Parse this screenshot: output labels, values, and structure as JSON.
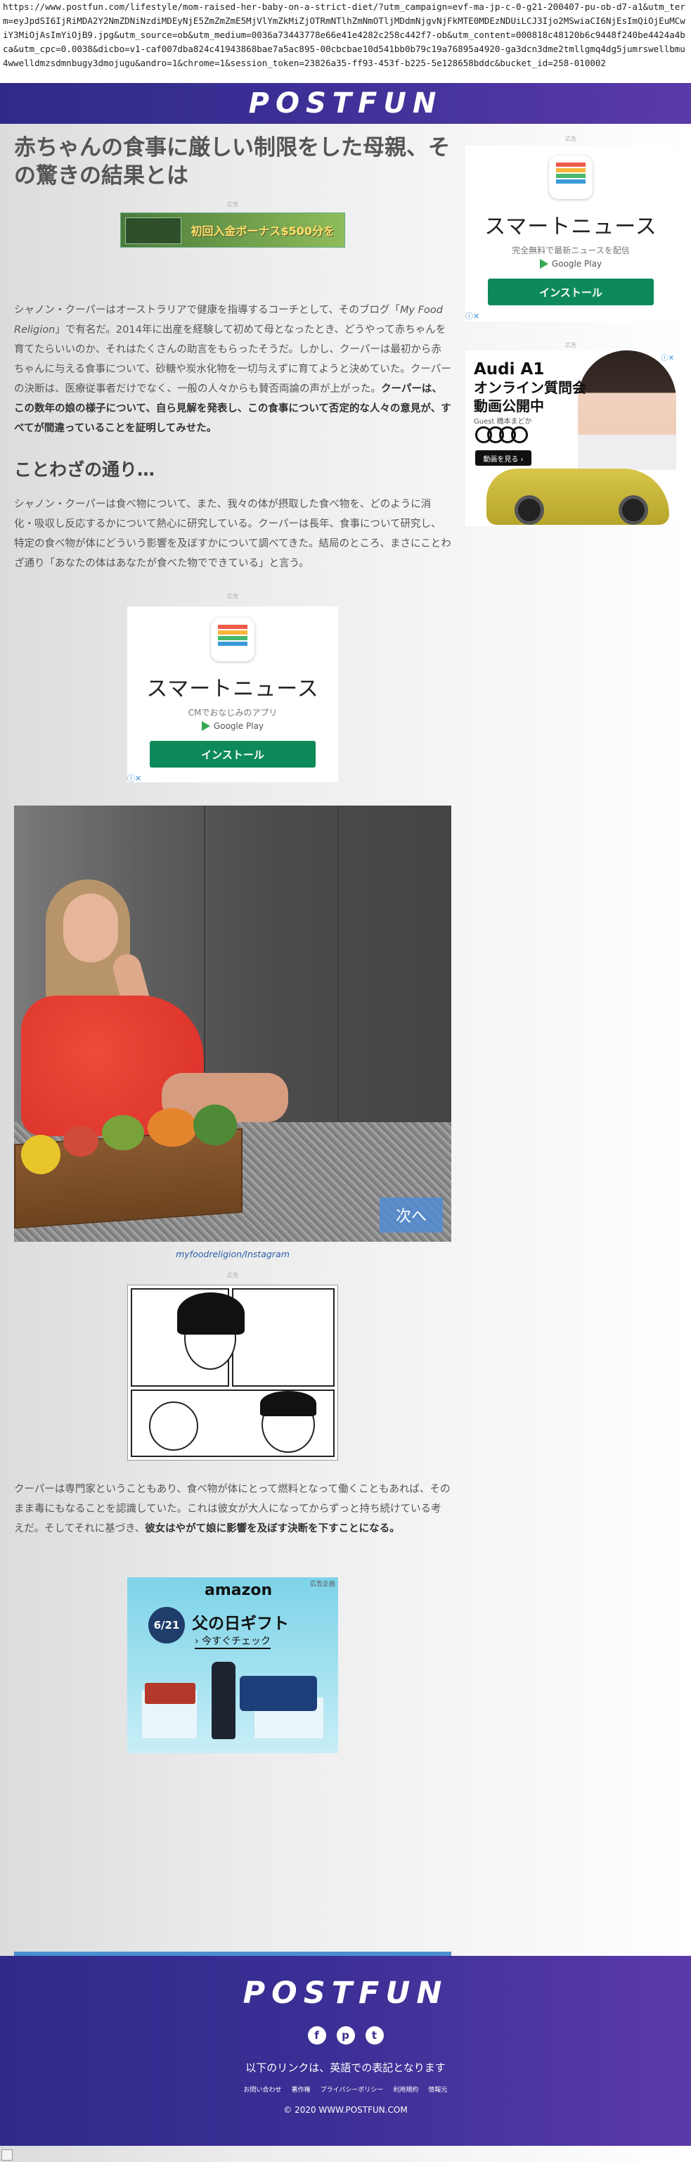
{
  "url_bar": {
    "text": "https://www.postfun.com/lifestyle/mom-raised-her-baby-on-a-strict-diet/?utm_campaign=evf-ma-jp-c-0-g21-200407-pu-ob-d7-a1&utm_term=eyJpdSI6IjRiMDA2Y2NmZDNiNzdiMDEyNjE5ZmZmZmE5MjVlYmZkMiZjOTRmNTlhZmNmOTljMDdmNjgvNjFkMTE0MDEzNDUiLCJ3Ijo2MSwiaCI6NjEsImQiOjEuMCwiY3MiOjAsImYiOjB9.jpg&utm_source=ob&utm_medium=0036a73443778e66e41e4282c258c442f7-ob&utm_content=000818c48120b6c9448f240be4424a4bca&utm_cpc=0.0038&dicbo=v1-caf007dba824c41943868bae7a5ac895-00cbcbae10d541bb0b79c19a76895a4920-ga3dcn3dme2tmllgmq4dg5jumrswellbmu4wwelldmzsdmnbugy3dmojugu&andro=1&chrome=1&session_token=23826a35-ff93-453f-b225-5e128658bddc&bucket_id=258-010002"
  },
  "header": {
    "logo": "POSTFUN"
  },
  "article": {
    "title": "赤ちゃんの食事に厳しい制限をした母親、その驚きの結果とは",
    "ad_label": "広告",
    "banner_ad_text": "初回入金ボーナス$500分を",
    "para1_a": "シャノン・クーパーはオーストラリアで健康を指導するコーチとして、そのブログ「",
    "para1_blog": "My Food Religion",
    "para1_b": "」で有名だ。2014年に出産を経験して初めて母となったとき、どうやって赤ちゃんを育てたらいいのか、それはたくさんの助言をもらったそうだ。しかし、クーパーは最初から赤ちゃんに与える食事について、砂糖や炭水化物を一切与えずに育てようと決めていた。クーパーの決断は、医療従事者だけでなく、一般の人々からも賛否両論の声が上がった。",
    "para1_bold": "クーパーは、この数年の娘の様子について、自ら見解を発表し、この食事について否定的な人々の意見が、すべてが間違っていることを証明してみせた。",
    "heading2": "ことわざの通り…",
    "para2": "シャノン・クーパーは食べ物について、また、我々の体が摂取した食べ物を、どのように消化・吸収し反応するかについて熱心に研究している。クーパーは長年、食事について研究し、特定の食べ物が体にどういう影響を及ぼすかについて調べてきた。結局のところ、まさにことわざ通り「あなたの体はあなたが食べた物でできている」と言う。",
    "image_caption": "myfoodreligion/Instagram",
    "next_label": "次へ",
    "para3_a": "クーパーは専門家ということもあり、食べ物が体にとって燃料となって働くこともあれば、その まま毒にもなることを認識していた。これは彼女が大人になってからずっと持ち続けている考えだ。そしてそれに基づき、",
    "para3_bold": "彼女はやがて娘に影響を及ぼす決断を下すことになる。",
    "big_next_label": "次へ"
  },
  "smartnews_ad_mid": {
    "title": "スマートニュース",
    "subtitle": "CMでおなじみのアプリ",
    "store": "Google Play",
    "install": "インストール"
  },
  "smartnews_ad_side": {
    "title": "スマートニュース",
    "subtitle": "完全無料で最新ニュースを配信",
    "store": "Google Play",
    "install": "インストール"
  },
  "audi_ad": {
    "title_line1": "Audi A1",
    "title_line2": "オンライン質問会",
    "title_line3": "動画公開中",
    "guest": "Guest 橋本まどか",
    "button": "動画を見る ›"
  },
  "amazon_ad": {
    "label": "広告企画",
    "brand": "amazon",
    "date": "6/21",
    "headline": "父の日ギフト",
    "link": "› 今すぐチェック"
  },
  "footer": {
    "logo": "POSTFUN",
    "note": "以下のリンクは、英語での表記となります",
    "links": [
      "お問い合わせ",
      "著作権",
      "プライバシーポリシー",
      "利用規約",
      "情報元"
    ],
    "copyright": "© 2020 WWW.POSTFUN.COM",
    "social": [
      "f",
      "p",
      "t"
    ]
  },
  "colors": {
    "header_bg": "#3b2f95",
    "next_button": "#4b8fd0",
    "install_button": "#0e8a5a",
    "caption_link": "#2a5ea8"
  }
}
